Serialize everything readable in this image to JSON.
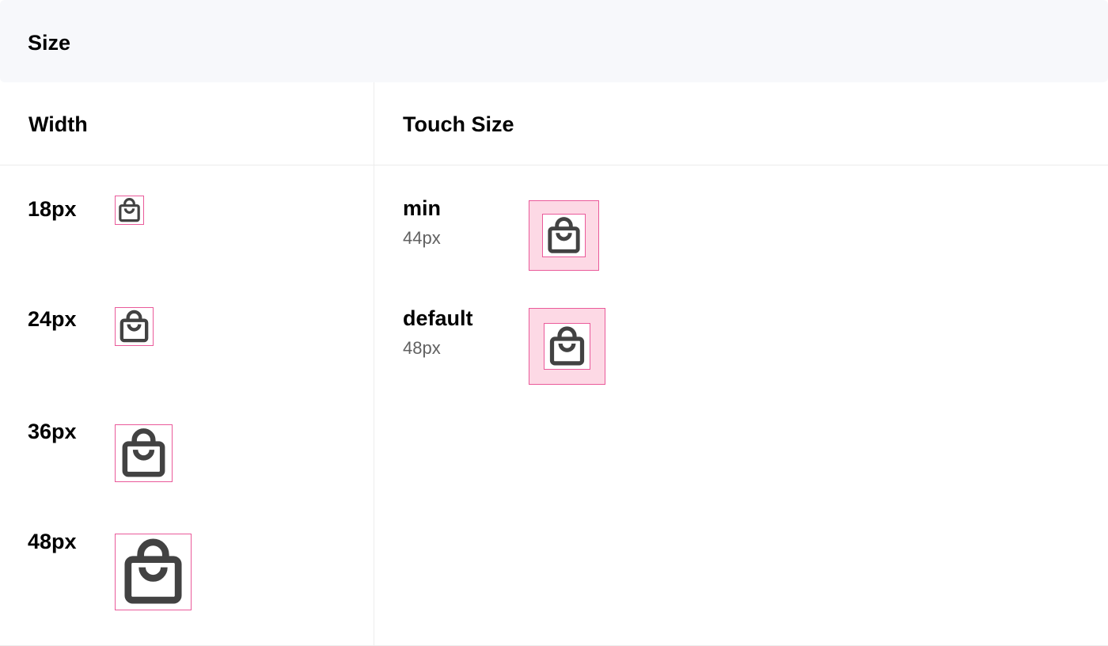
{
  "header": {
    "title": "Size"
  },
  "columns": {
    "width_title": "Width",
    "touch_title": "Touch Size"
  },
  "widths": [
    {
      "label": "18px",
      "icon": "shopping-bag-icon"
    },
    {
      "label": "24px",
      "icon": "shopping-bag-icon"
    },
    {
      "label": "36px",
      "icon": "shopping-bag-icon"
    },
    {
      "label": "48px",
      "icon": "shopping-bag-icon"
    }
  ],
  "touch_sizes": [
    {
      "name": "min",
      "value": "44px",
      "icon": "shopping-bag-icon"
    },
    {
      "name": "default",
      "value": "48px",
      "icon": "shopping-bag-icon"
    }
  ],
  "colors": {
    "icon": "#424242",
    "frame_border": "#ea5a9a",
    "touch_fill": "#fdd9e5",
    "header_bg": "#f7f8fb",
    "secondary_text": "#616161"
  }
}
